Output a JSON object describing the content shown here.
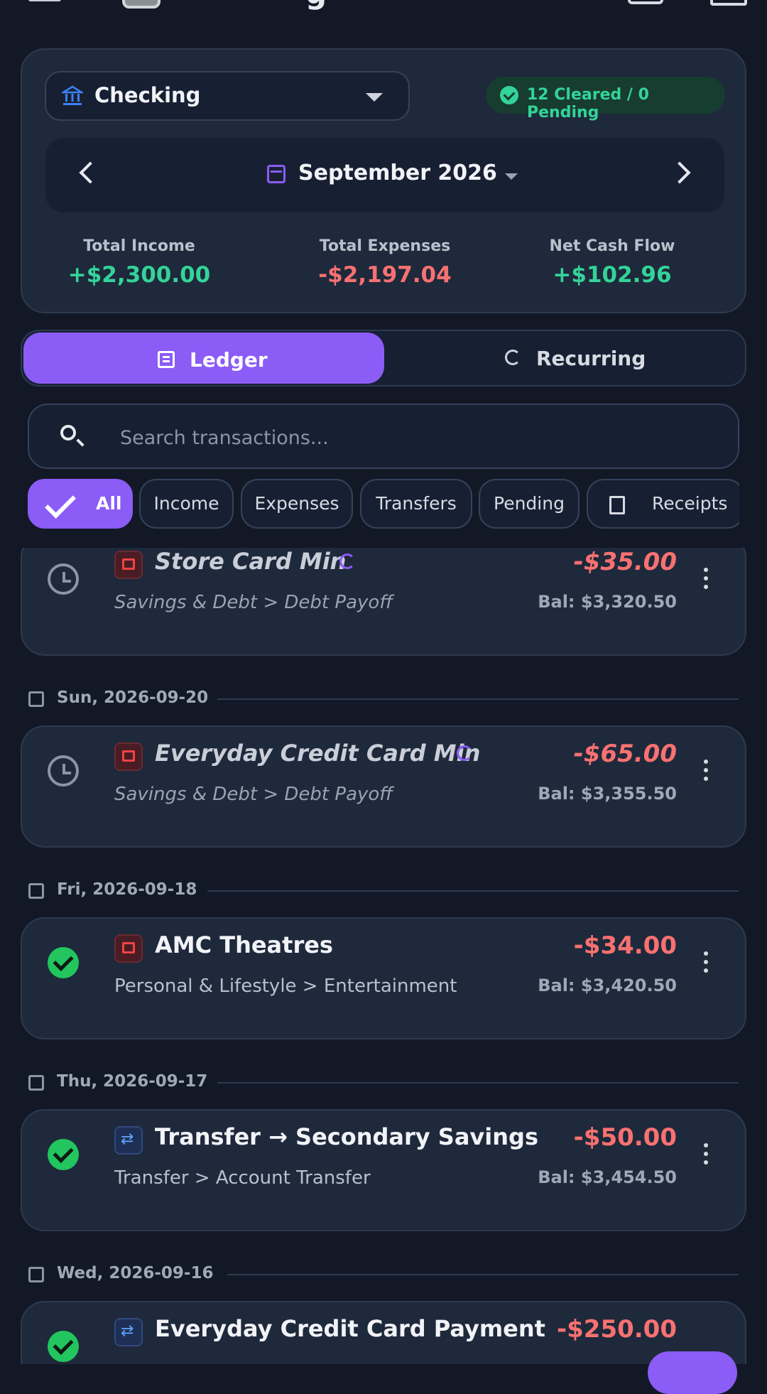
{
  "header": {
    "title": "g"
  },
  "account": {
    "name": "Checking",
    "status": "12 Cleared / 0 Pending"
  },
  "period": {
    "label": "September 2026"
  },
  "summary": {
    "income_label": "Total Income",
    "income": "+$2,300.00",
    "expenses_label": "Total Expenses",
    "expenses": "-$2,197.04",
    "net_label": "Net Cash Flow",
    "net": "+$102.96"
  },
  "tabs": {
    "ledger": "Ledger",
    "recurring": "Recurring"
  },
  "search": {
    "placeholder": "Search transactions..."
  },
  "filters": [
    "All",
    "Income",
    "Expenses",
    "Transfers",
    "Pending",
    "Receipts"
  ],
  "transactions": [
    {
      "title": "Store Card Min",
      "category": "Savings & Debt > Debt Payoff",
      "amount": "-$35.00",
      "balance": "Bal: $3,320.50"
    },
    {
      "date": "Sun, 2026-09-20",
      "title": "Everyday Credit Card Min",
      "category": "Savings & Debt > Debt Payoff",
      "amount": "-$65.00",
      "balance": "Bal: $3,355.50"
    },
    {
      "date": "Fri, 2026-09-18",
      "title": "AMC Theatres",
      "category": "Personal & Lifestyle > Entertainment",
      "amount": "-$34.00",
      "balance": "Bal: $3,420.50"
    },
    {
      "date": "Thu, 2026-09-17",
      "title": "Transfer → Secondary Savings",
      "category": "Transfer > Account Transfer",
      "amount": "-$50.00",
      "balance": "Bal: $3,454.50"
    },
    {
      "date": "Wed, 2026-09-16",
      "title": "Everyday Credit Card Payment",
      "amount": "-$250.00"
    }
  ],
  "colors": {
    "accent": "#8b5cf6",
    "positive": "#34d399",
    "negative": "#f87171",
    "background": "#121826",
    "card": "#1e293b"
  }
}
